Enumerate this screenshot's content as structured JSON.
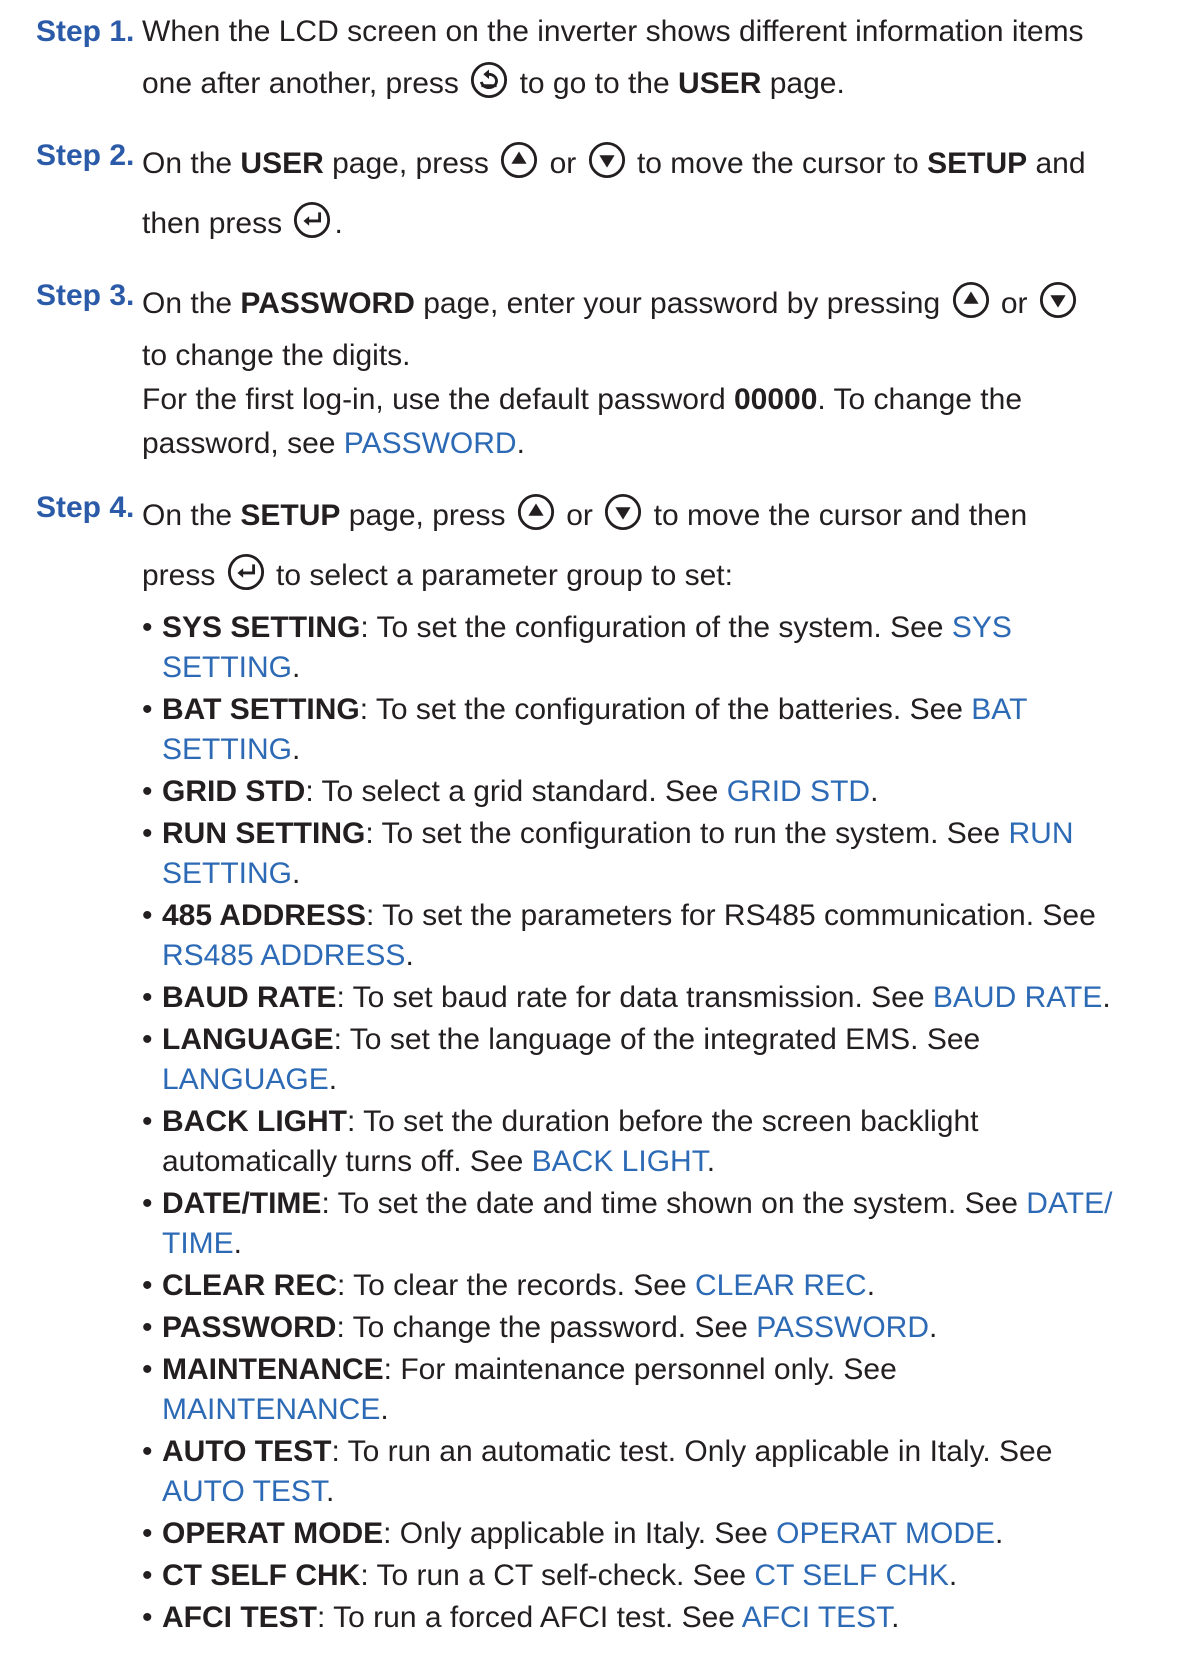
{
  "steps": [
    {
      "num": "Step 1.",
      "t1": "When the LCD screen on the inverter shows different information items",
      "t2": "one after another, press",
      "t3": "to go to the",
      "t4": "USER",
      "t5": "page."
    },
    {
      "num": "Step 2.",
      "t1": "On the",
      "t2": "USER",
      "t3": "page, press",
      "t4": "or",
      "t5": "to move the cursor to",
      "t6": "SETUP",
      "t7": "and",
      "t8": "then press",
      "t9": "."
    },
    {
      "num": "Step 3.",
      "t1": "On the",
      "t2": "PASSWORD",
      "t3": "page, enter your password by pressing",
      "t4": "or",
      "t5": "to change the digits.",
      "t6": "For the first log-in, use the default password",
      "t7": "00000",
      "t8": ". To change the",
      "t9": "password, see",
      "link": "PASSWORD",
      "t10": "."
    },
    {
      "num": "Step 4.",
      "t1": "On the",
      "t2": "SETUP",
      "t3": "page, press",
      "t4": "or",
      "t5": "to move the cursor and then",
      "t6": "press",
      "t7": "to select a parameter group to set:"
    }
  ],
  "bullets": [
    {
      "name": "SYS SETTING",
      "desc": ": To set the configuration of the system. See ",
      "link1": "SYS",
      "link2": "SETTING",
      "end": "."
    },
    {
      "name": "BAT SETTING",
      "desc": ": To set the configuration of the batteries. See ",
      "link1": "BAT",
      "link2": "SETTING",
      "end": "."
    },
    {
      "name": "GRID STD",
      "desc": ": To select a grid standard. See ",
      "link1": "GRID STD",
      "link2": "",
      "end": "."
    },
    {
      "name": "RUN SETTING",
      "desc": ": To set the configuration to run the system. See ",
      "link1": "RUN",
      "link2": "SETTING",
      "end": "."
    },
    {
      "name": "485 ADDRESS",
      "desc": ": To set the parameters for RS485 communication. See",
      "link1": "",
      "link2": "RS485 ADDRESS",
      "end": "."
    },
    {
      "name": "BAUD RATE",
      "desc": ": To set baud rate for data transmission. See ",
      "link1": "BAUD RATE",
      "link2": "",
      "end": "."
    },
    {
      "name": "LANGUAGE",
      "desc": ": To set the language of the integrated EMS. See",
      "link1": "",
      "link2": "LANGUAGE",
      "end": "."
    },
    {
      "name": "BACK LIGHT",
      "desc": ": To set the duration before the screen backlight",
      "desc2": "automatically turns off. See ",
      "link1": "",
      "link2": "BACK LIGHT",
      "end": "."
    },
    {
      "name": "DATE/TIME",
      "desc": ": To set the date and time shown on the system. See ",
      "link1": "DATE/",
      "link2": "TIME",
      "end": "."
    },
    {
      "name": "CLEAR REC",
      "desc": ": To clear the records. See ",
      "link1": "CLEAR REC",
      "link2": "",
      "end": "."
    },
    {
      "name": "PASSWORD",
      "desc": ": To change the password. See ",
      "link1": "PASSWORD",
      "link2": "",
      "end": "."
    },
    {
      "name": "MAINTENANCE",
      "desc": ": For maintenance personnel only. See",
      "link1": "",
      "link2": "MAINTENANCE",
      "end": "."
    },
    {
      "name": "AUTO TEST",
      "desc": ": To run an automatic test. Only applicable in Italy. See",
      "link1": "",
      "link2": "AUTO TEST",
      "end": "."
    },
    {
      "name": "OPERAT MODE",
      "desc": ": Only applicable in Italy. See ",
      "link1": "OPERAT MODE",
      "link2": "",
      "end": "."
    },
    {
      "name": "CT SELF CHK",
      "desc": ": To run a CT self-check. See ",
      "link1": "CT SELF CHK",
      "link2": "",
      "end": "."
    },
    {
      "name": "AFCI TEST",
      "desc": ": To run a forced AFCI test. See ",
      "link1": "AFCI TEST",
      "link2": "",
      "end": "."
    }
  ],
  "colors": {
    "step_label": "#2b5ba8",
    "link": "#2d6ab5",
    "text": "#231f20"
  },
  "icons": {
    "back": "back-button-icon",
    "up": "up-button-icon",
    "down": "down-button-icon",
    "enter": "enter-button-icon"
  }
}
